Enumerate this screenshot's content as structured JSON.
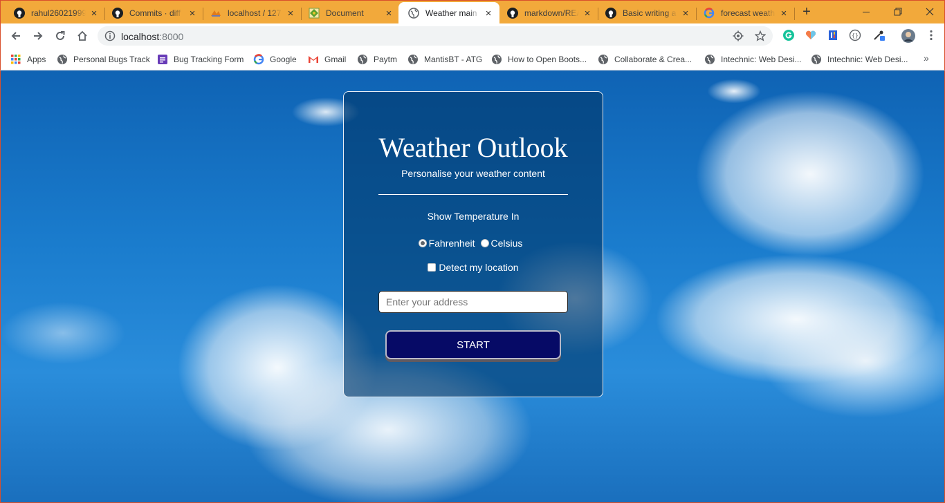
{
  "browser": {
    "tabs": [
      {
        "title": "rahul26021999",
        "icon": "github-icon"
      },
      {
        "title": "Commits · diff",
        "icon": "github-icon"
      },
      {
        "title": "localhost / 127",
        "icon": "phpmyadmin-icon"
      },
      {
        "title": "Document",
        "icon": "document-favicon"
      },
      {
        "title": "Weather main",
        "icon": "globe-icon",
        "active": true
      },
      {
        "title": "markdown/REA",
        "icon": "github-icon"
      },
      {
        "title": "Basic writing a",
        "icon": "github-icon"
      },
      {
        "title": "forecast weath",
        "icon": "google-icon"
      }
    ],
    "new_tab_label": "+",
    "url": {
      "host": "localhost",
      "port": ":8000"
    },
    "bookmarks": [
      {
        "label": "Apps",
        "icon": "apps-grid-icon"
      },
      {
        "label": "Personal Bugs Track",
        "icon": "globe-icon"
      },
      {
        "label": "Bug Tracking Form",
        "icon": "forms-icon"
      },
      {
        "label": "Google",
        "icon": "google-icon"
      },
      {
        "label": "Gmail",
        "icon": "gmail-icon"
      },
      {
        "label": "Paytm",
        "icon": "globe-icon"
      },
      {
        "label": "MantisBT - ATG",
        "icon": "globe-icon"
      },
      {
        "label": "How to Open Boots...",
        "icon": "globe-icon"
      },
      {
        "label": "Collaborate & Crea...",
        "icon": "globe-icon"
      },
      {
        "label": "Intechnic: Web Desi...",
        "icon": "globe-icon"
      },
      {
        "label": "Intechnic: Web Desi...",
        "icon": "globe-icon"
      }
    ],
    "more_bookmarks": "»"
  },
  "card": {
    "title": "Weather Outlook",
    "subtitle": "Personalise your weather content",
    "unit_heading": "Show Temperature In",
    "unit_options": [
      {
        "label": "Fahrenheit",
        "checked": true
      },
      {
        "label": "Celsius",
        "checked": false
      }
    ],
    "detect_location_label": "Detect my location",
    "detect_location_checked": false,
    "address_placeholder": "Enter your address",
    "address_value": "",
    "start_label": "START"
  },
  "colors": {
    "tab_strip": "#f2a93b",
    "card_overlay": "#00376a",
    "start_button": "#060a66"
  }
}
